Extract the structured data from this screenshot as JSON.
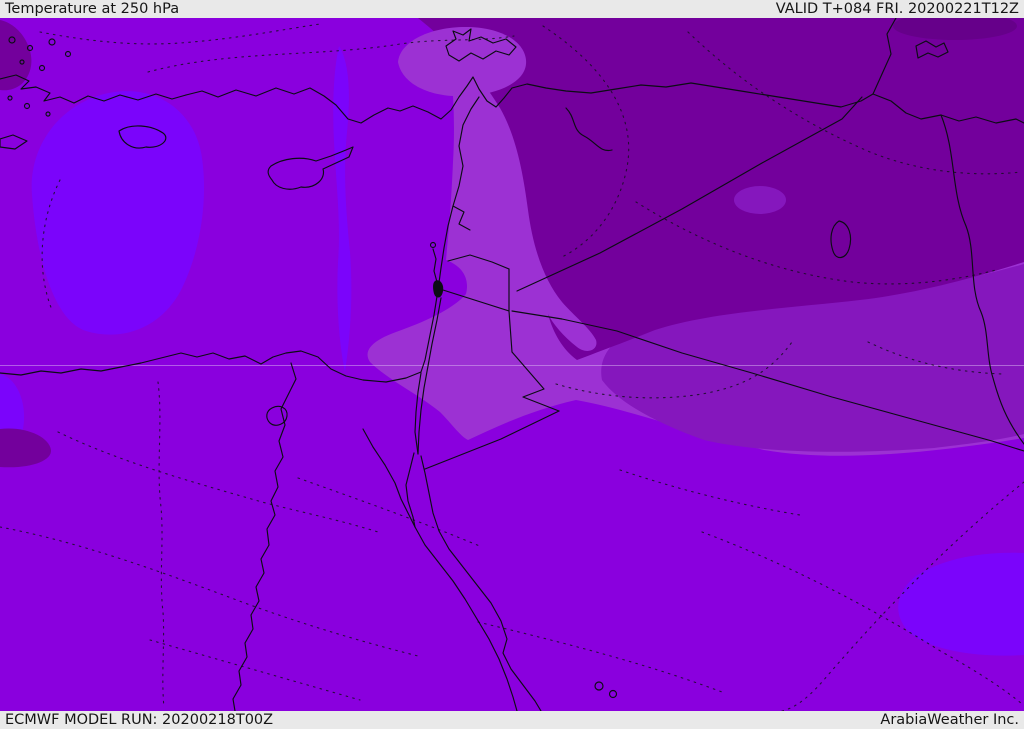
{
  "header": {
    "title": "Temperature at 250 hPa",
    "valid": "VALID T+084 FRI. 20200221T12Z"
  },
  "footer": {
    "model_run": "ECMWF MODEL RUN: 20200218T00Z",
    "attribution": "ArabiaWeather Inc."
  },
  "map": {
    "parameter": "Temperature",
    "pressure_level": "250 hPa",
    "model": "ECMWF",
    "run": "20200218T00Z",
    "valid_time": "20200221T12Z",
    "forecast_hour": "T+084",
    "colors": {
      "base": "#8a00de",
      "bright": "#7b04fb",
      "lavender": "#9c31d3",
      "medium": "#8517bd",
      "dark": "#73009c",
      "extra_dark": "#66008a",
      "line": "#0c0c14",
      "contour": "#170f22",
      "graticule": "#d9b8f2"
    },
    "chrome": {
      "bar_bg": "#e9e9e9",
      "text_color": "#161616"
    }
  }
}
